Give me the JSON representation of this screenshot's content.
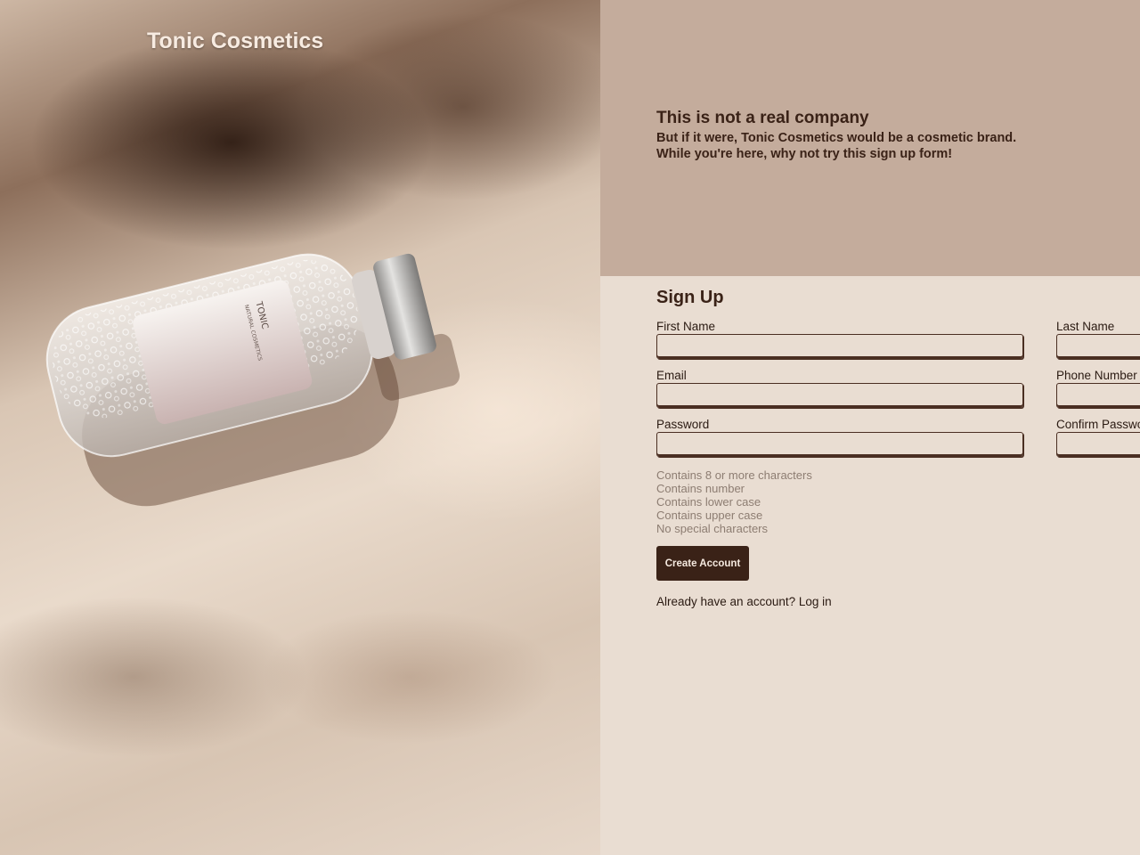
{
  "brand": {
    "name": "Tonic Cosmetics"
  },
  "hero": {
    "bottle_label_brand": "TONIC",
    "bottle_label_line": "NATURAL COSMETICS"
  },
  "info": {
    "heading": "This is not a real company",
    "body": "But if it were, Tonic Cosmetics would be a cosmetic brand.\nWhile you're here, why not try this sign up form!"
  },
  "form": {
    "title": "Sign Up",
    "fields": {
      "first_name": {
        "label": "First Name",
        "value": ""
      },
      "last_name": {
        "label": "Last Name",
        "value": ""
      },
      "email": {
        "label": "Email",
        "value": ""
      },
      "phone": {
        "label": "Phone Number",
        "value": ""
      },
      "password": {
        "label": "Password",
        "value": ""
      },
      "confirm_password": {
        "label": "Confirm Password",
        "value": ""
      }
    },
    "password_requirements": [
      "Contains 8 or more characters",
      "Contains number",
      "Contains lower case",
      "Contains upper case",
      "No special characters"
    ],
    "submit_label": "Create Account",
    "login_prompt": "Already have an account?",
    "login_link": "Log in"
  },
  "colors": {
    "info_bg": "#c4ac9c",
    "form_bg": "#e9ddd2",
    "primary_dark": "#3a2217"
  }
}
